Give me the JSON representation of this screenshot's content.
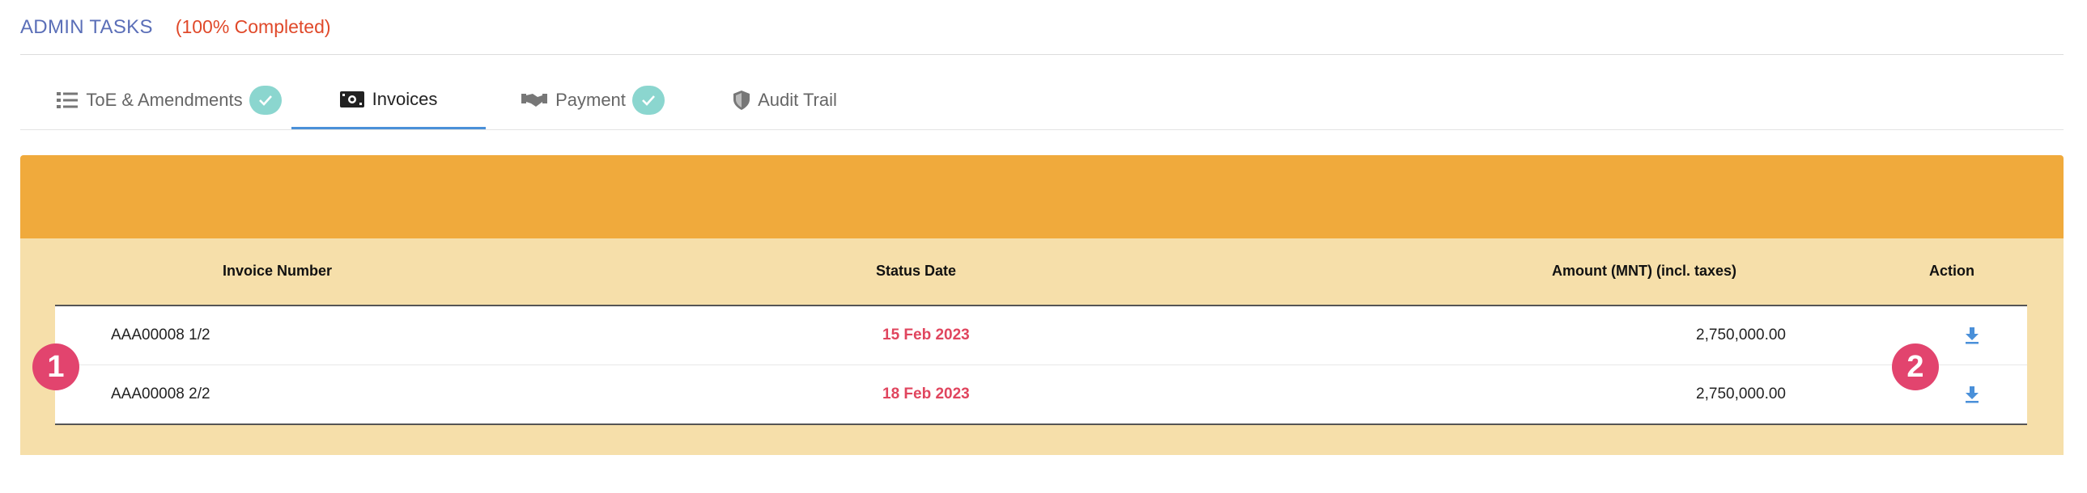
{
  "header": {
    "title": "ADMIN TASKS",
    "progress": "(100% Completed)"
  },
  "tabs": [
    {
      "label": "ToE & Amendments",
      "icon": "list-icon",
      "completed": true
    },
    {
      "label": "Invoices",
      "icon": "money-bill-icon",
      "active": true
    },
    {
      "label": "Payment",
      "icon": "handshake-icon",
      "completed": true
    },
    {
      "label": "Audit Trail",
      "icon": "shield-icon"
    }
  ],
  "table": {
    "columns": [
      "Invoice Number",
      "Status Date",
      "Amount (MNT) (incl. taxes)",
      "Action"
    ],
    "rows": [
      {
        "invoice": "AAA00008 1/2",
        "date": "15 Feb 2023",
        "amount": "2,750,000.00",
        "action_icon": "download-icon"
      },
      {
        "invoice": "AAA00008 2/2",
        "date": "18 Feb 2023",
        "amount": "2,750,000.00",
        "action_icon": "download-icon"
      }
    ]
  },
  "markers": [
    "1",
    "2"
  ],
  "colors": {
    "accent": "#5b6fb8",
    "progress": "#e0492a",
    "banner": "#f0aa3c",
    "panel": "#f6dfaa",
    "date": "#e0455e",
    "check_badge": "#8bd6cf",
    "marker": "#e2446e",
    "download": "#4a90d9"
  }
}
